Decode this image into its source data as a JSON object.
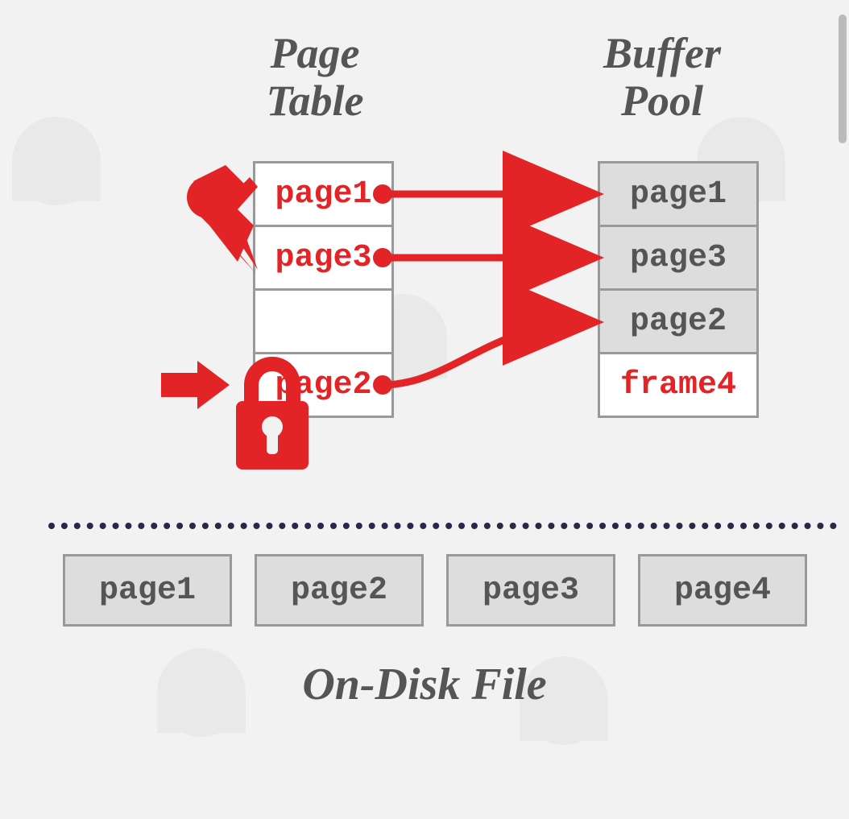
{
  "titles": {
    "page_table_l1": "Page",
    "page_table_l2": "Table",
    "buffer_pool_l1": "Buffer",
    "buffer_pool_l2": "Pool",
    "on_disk": "On-Disk File"
  },
  "page_table": {
    "slot0": "page1",
    "slot1": "page3",
    "slot2": "",
    "slot3": "page2"
  },
  "buffer_pool": {
    "slot0": "page1",
    "slot1": "page3",
    "slot2": "page2",
    "slot3": "frame4"
  },
  "disk": {
    "p0": "page1",
    "p1": "page2",
    "p2": "page3",
    "p3": "page4"
  },
  "colors": {
    "red": "#e32427",
    "gray": "#555"
  }
}
